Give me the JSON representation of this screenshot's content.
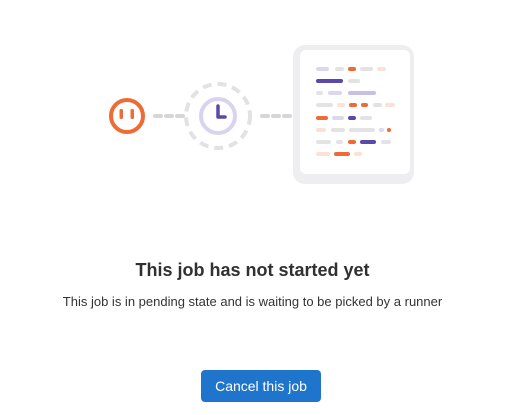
{
  "empty_state": {
    "title": "This job has not started yet",
    "description": "This job is in pending state and is waiting to be picked by a runner",
    "cancel_button_label": "Cancel this job"
  },
  "illustration": {
    "icons": [
      "runner-plug-icon",
      "clock-icon",
      "job-log-document-icon"
    ]
  },
  "colors": {
    "accent_orange": "#ef6a34",
    "accent_purple": "#5c48a8",
    "primary_blue": "#1f75cb",
    "neutral_gray": "#dcdcde"
  }
}
